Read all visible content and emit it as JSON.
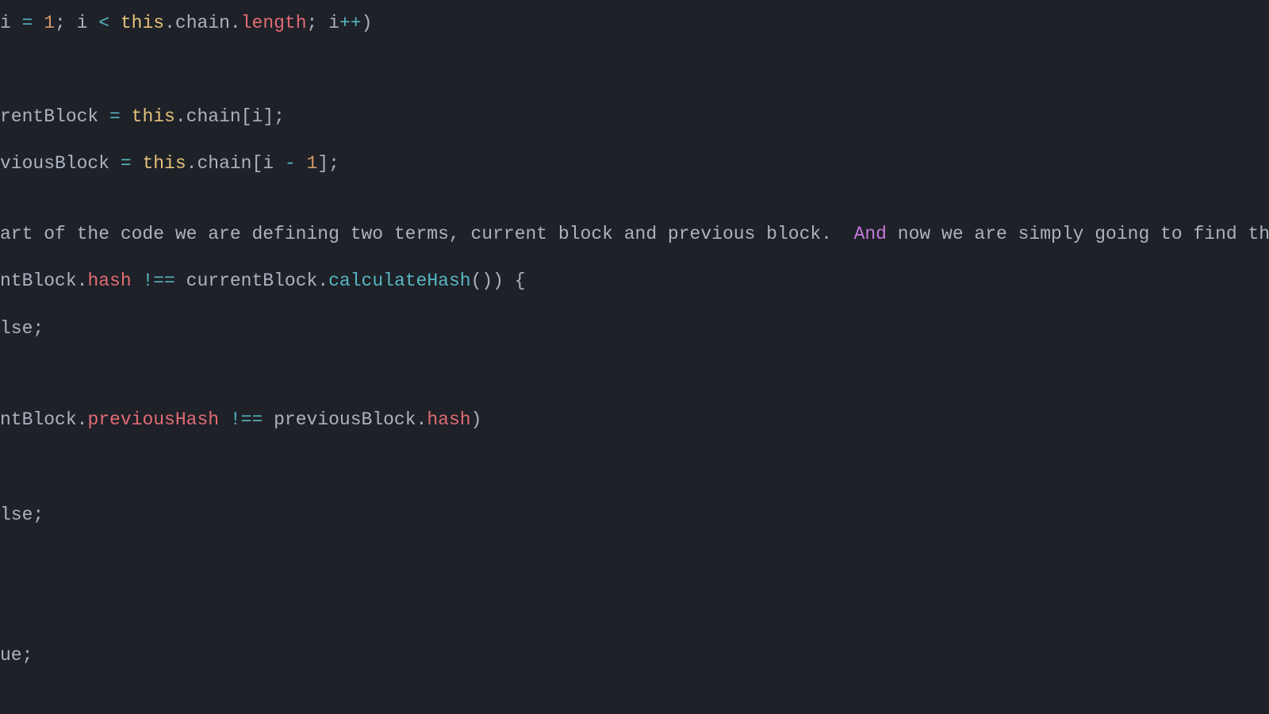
{
  "code": {
    "lines": [
      {
        "id": "l1",
        "tokens": [
          {
            "cls": "tok-ident",
            "t": "i "
          },
          {
            "cls": "tok-operator",
            "t": "= "
          },
          {
            "cls": "tok-number",
            "t": "1"
          },
          {
            "cls": "tok-punct",
            "t": "; "
          },
          {
            "cls": "tok-ident",
            "t": "i "
          },
          {
            "cls": "tok-operator",
            "t": "< "
          },
          {
            "cls": "tok-this",
            "t": "this"
          },
          {
            "cls": "tok-punct",
            "t": "."
          },
          {
            "cls": "tok-ident",
            "t": "chain"
          },
          {
            "cls": "tok-punct",
            "t": "."
          },
          {
            "cls": "tok-prop2",
            "t": "length"
          },
          {
            "cls": "tok-punct",
            "t": "; "
          },
          {
            "cls": "tok-ident",
            "t": "i"
          },
          {
            "cls": "tok-operator",
            "t": "++"
          },
          {
            "cls": "tok-punct",
            "t": ")"
          }
        ]
      },
      {
        "id": "l2",
        "tokens": [
          {
            "cls": "tok-default",
            "t": ""
          }
        ]
      },
      {
        "id": "l3",
        "tokens": [
          {
            "cls": "tok-ident",
            "t": "rentBlock "
          },
          {
            "cls": "tok-operator",
            "t": "= "
          },
          {
            "cls": "tok-this",
            "t": "this"
          },
          {
            "cls": "tok-punct",
            "t": "."
          },
          {
            "cls": "tok-ident",
            "t": "chain"
          },
          {
            "cls": "tok-punct",
            "t": "["
          },
          {
            "cls": "tok-ident",
            "t": "i"
          },
          {
            "cls": "tok-punct",
            "t": "];"
          }
        ]
      },
      {
        "id": "l4",
        "tokens": [
          {
            "cls": "tok-ident",
            "t": "viousBlock "
          },
          {
            "cls": "tok-operator",
            "t": "= "
          },
          {
            "cls": "tok-this",
            "t": "this"
          },
          {
            "cls": "tok-punct",
            "t": "."
          },
          {
            "cls": "tok-ident",
            "t": "chain"
          },
          {
            "cls": "tok-punct",
            "t": "["
          },
          {
            "cls": "tok-ident",
            "t": "i "
          },
          {
            "cls": "tok-operator",
            "t": "- "
          },
          {
            "cls": "tok-number",
            "t": "1"
          },
          {
            "cls": "tok-punct",
            "t": "];"
          }
        ]
      },
      {
        "id": "l5",
        "tokens": [
          {
            "cls": "tok-default",
            "t": ""
          }
        ]
      },
      {
        "id": "l6",
        "tokens": [
          {
            "cls": "tok-ident",
            "t": "art of the code we are defining two terms, current block and previous block.  "
          },
          {
            "cls": "tok-and",
            "t": "And"
          },
          {
            "cls": "tok-ident",
            "t": " now we are simply going to find the hash of these t"
          }
        ]
      },
      {
        "id": "l7",
        "tokens": [
          {
            "cls": "tok-ident",
            "t": "ntBlock"
          },
          {
            "cls": "tok-punct",
            "t": "."
          },
          {
            "cls": "tok-prop2",
            "t": "hash "
          },
          {
            "cls": "tok-operator",
            "t": "!== "
          },
          {
            "cls": "tok-ident",
            "t": "currentBlock"
          },
          {
            "cls": "tok-punct",
            "t": "."
          },
          {
            "cls": "tok-method",
            "t": "calculateHash"
          },
          {
            "cls": "tok-punct",
            "t": "()) {"
          }
        ]
      },
      {
        "id": "l8",
        "tokens": [
          {
            "cls": "tok-ident",
            "t": "lse"
          },
          {
            "cls": "tok-punct",
            "t": ";"
          }
        ]
      },
      {
        "id": "l9",
        "tokens": [
          {
            "cls": "tok-default",
            "t": ""
          }
        ]
      },
      {
        "id": "l10",
        "tokens": [
          {
            "cls": "tok-ident",
            "t": "ntBlock"
          },
          {
            "cls": "tok-punct",
            "t": "."
          },
          {
            "cls": "tok-prop2",
            "t": "previousHash "
          },
          {
            "cls": "tok-operator",
            "t": "!== "
          },
          {
            "cls": "tok-ident",
            "t": "previousBlock"
          },
          {
            "cls": "tok-punct",
            "t": "."
          },
          {
            "cls": "tok-prop2",
            "t": "hash"
          },
          {
            "cls": "tok-punct",
            "t": ")"
          }
        ]
      },
      {
        "id": "l11",
        "tokens": [
          {
            "cls": "tok-default",
            "t": ""
          }
        ]
      },
      {
        "id": "l12",
        "tokens": [
          {
            "cls": "tok-ident",
            "t": "lse"
          },
          {
            "cls": "tok-punct",
            "t": ";"
          }
        ]
      },
      {
        "id": "l13",
        "tokens": [
          {
            "cls": "tok-default",
            "t": ""
          }
        ]
      },
      {
        "id": "l14",
        "tokens": [
          {
            "cls": "tok-default",
            "t": ""
          }
        ]
      },
      {
        "id": "l15",
        "tokens": [
          {
            "cls": "tok-ident",
            "t": "ue"
          },
          {
            "cls": "tok-punct",
            "t": ";"
          }
        ]
      }
    ],
    "line_positions": [
      0,
      95,
      118,
      177,
      260,
      266,
      325,
      385,
      435,
      500,
      555,
      620,
      672,
      730,
      797
    ]
  }
}
